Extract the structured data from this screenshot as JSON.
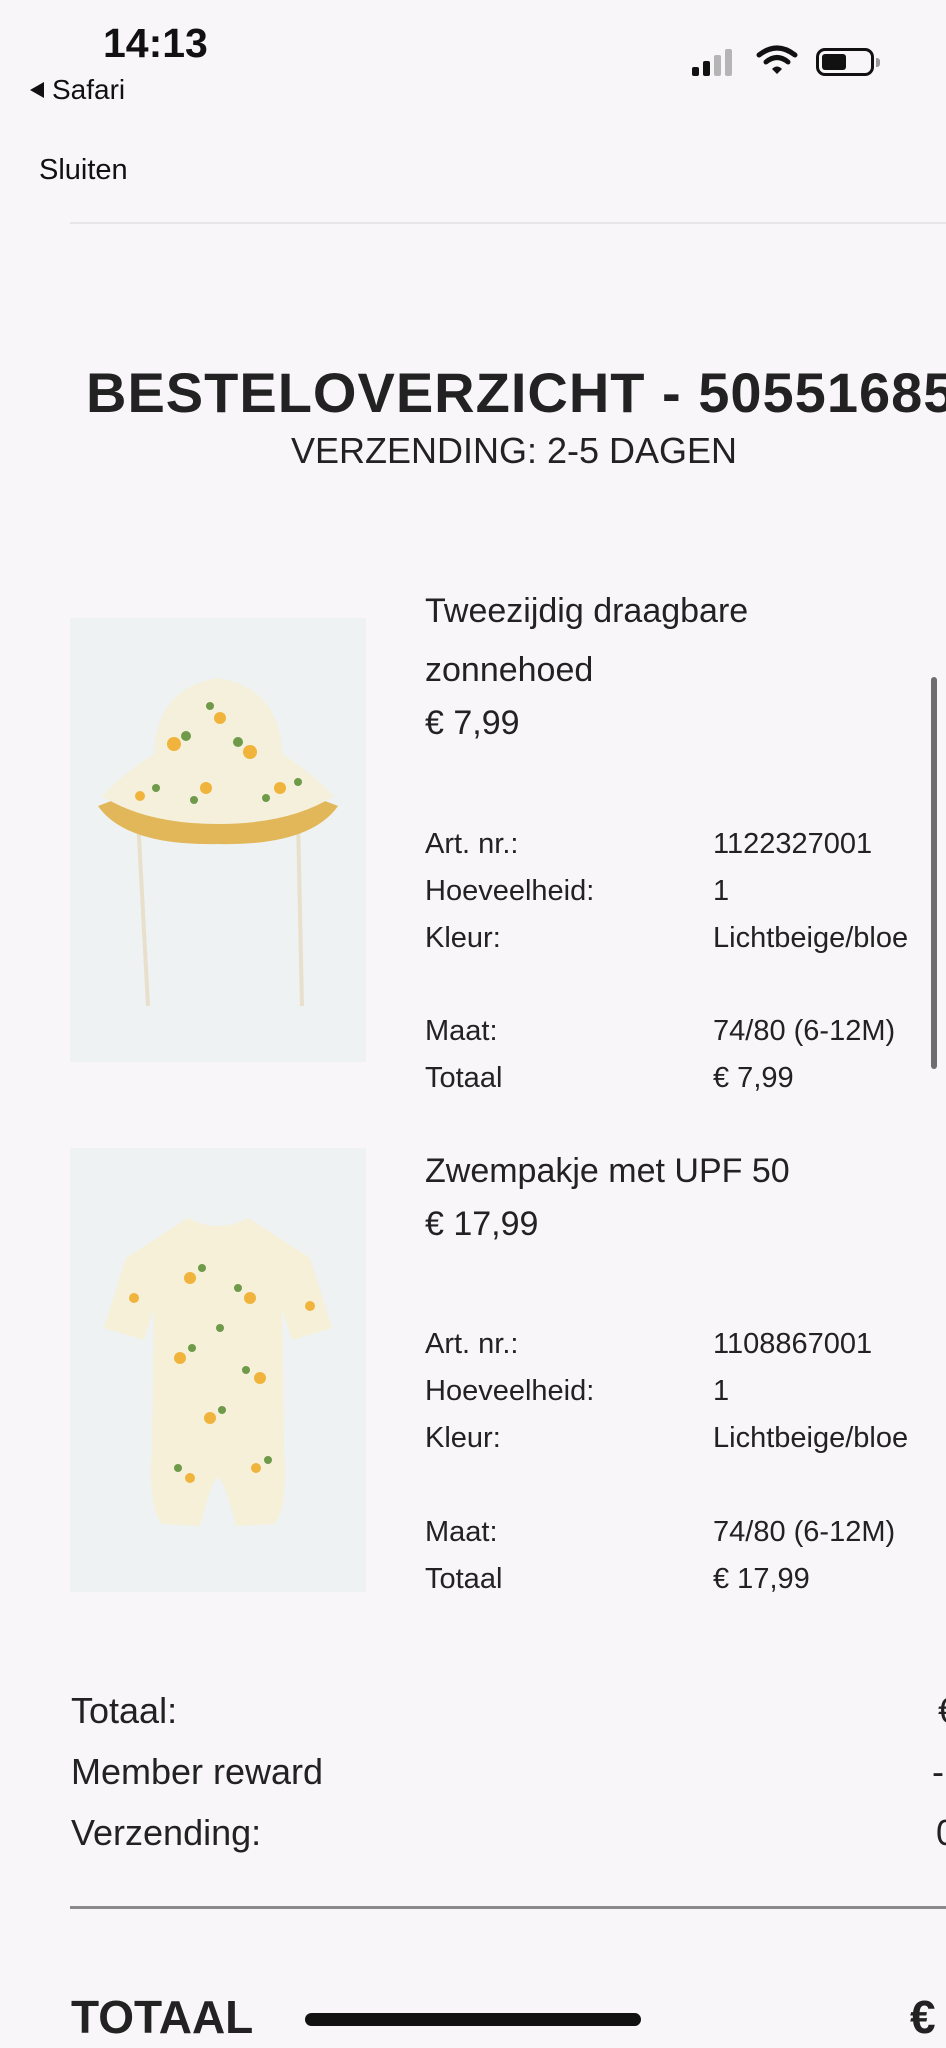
{
  "status_bar": {
    "time": "14:13",
    "back_app": "Safari"
  },
  "nav": {
    "close_label": "Sluiten"
  },
  "order": {
    "title": "BESTELOVERZICHT - 50551685",
    "shipping": "VERZENDING:  2-5 DAGEN"
  },
  "products": [
    {
      "name": "Tweezijdig draagbare zonnehoed",
      "price": "€ 7,99",
      "details": [
        {
          "label": "Art. nr.:",
          "value": "1122327001"
        },
        {
          "label": "Hoeveelheid:",
          "value": "1"
        },
        {
          "label": "Kleur:",
          "value": "Lichtbeige/bloe"
        },
        {
          "label": "Maat:",
          "value": "74/80 (6-12M)"
        },
        {
          "label": "Totaal",
          "value": "€ 7,99"
        }
      ]
    },
    {
      "name": "Zwempakje met UPF 50",
      "price": "€ 17,99",
      "details": [
        {
          "label": "Art. nr.:",
          "value": "1108867001"
        },
        {
          "label": "Hoeveelheid:",
          "value": "1"
        },
        {
          "label": "Kleur:",
          "value": "Lichtbeige/bloe"
        },
        {
          "label": "Maat:",
          "value": "74/80 (6-12M)"
        },
        {
          "label": "Totaal",
          "value": "€ 17,99"
        }
      ]
    }
  ],
  "summary": {
    "subtotal_label": "Totaal:",
    "subtotal_value": "€",
    "reward_label": "Member reward",
    "reward_value": "-",
    "shipping_label": "Verzending:",
    "shipping_value": "0",
    "grand_label": "TOTAAL",
    "grand_value": "€"
  },
  "colors": {
    "background": "#f8f6f8",
    "text": "#222222"
  }
}
